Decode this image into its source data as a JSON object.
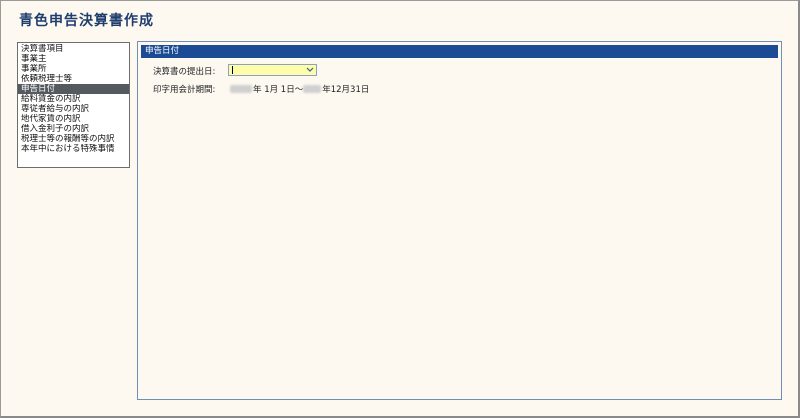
{
  "app": {
    "title": "青色申告決算書作成"
  },
  "sidebar": {
    "items": [
      {
        "label": "決算書項目",
        "selected": false
      },
      {
        "label": "事業主",
        "selected": false
      },
      {
        "label": "事業所",
        "selected": false
      },
      {
        "label": "依頼税理士等",
        "selected": false
      },
      {
        "label": "申告日付",
        "selected": true
      },
      {
        "label": "給料賃金の内訳",
        "selected": false
      },
      {
        "label": "専従者給与の内訳",
        "selected": false
      },
      {
        "label": "地代家賃の内訳",
        "selected": false
      },
      {
        "label": "借入金利子の内訳",
        "selected": false
      },
      {
        "label": "税理士等の報酬等の内訳",
        "selected": false
      },
      {
        "label": "本年中における特殊事情",
        "selected": false
      }
    ]
  },
  "panel": {
    "header": "申告日付",
    "submission_date": {
      "label": "決算書の提出日:",
      "value": ""
    },
    "print_period": {
      "label": "印字用会計期間:",
      "start_suffix": "年 1月 1日～",
      "end_suffix": "年12月31日"
    }
  },
  "colors": {
    "header": "#1c4b95",
    "input_bg": "#fdfdaa",
    "selected_bg": "#555a60"
  },
  "icons": {
    "dropdown": "chevron-down-icon"
  }
}
